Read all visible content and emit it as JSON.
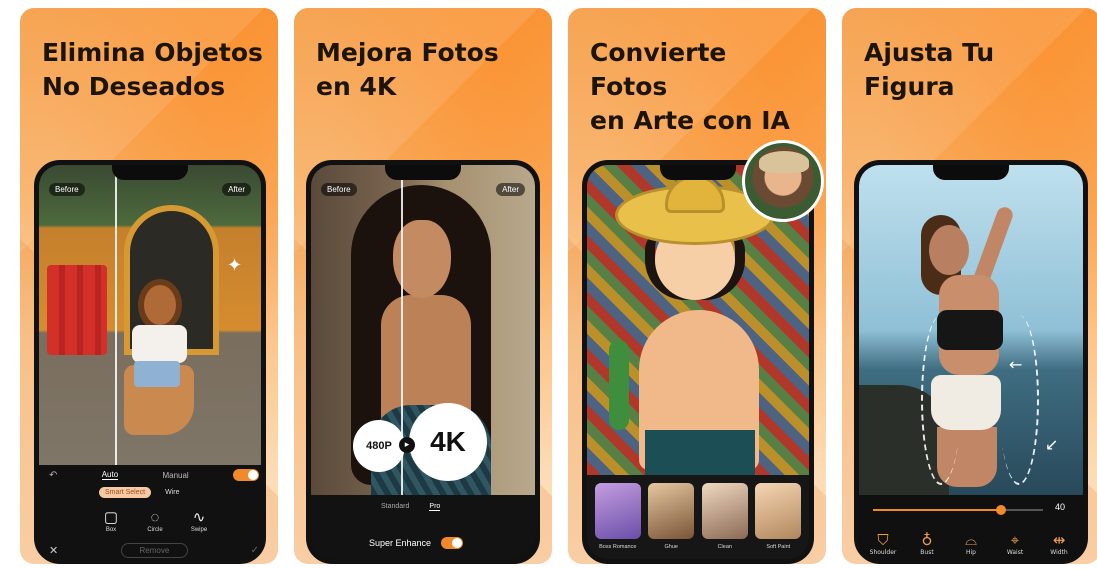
{
  "panels": [
    {
      "title": "Elimina Objetos\nNo Deseados",
      "before_label": "Before",
      "after_label": "After",
      "mode_tabs": [
        "Auto",
        "Manual"
      ],
      "select_options": [
        "Smart Select",
        "Wire"
      ],
      "tools": [
        {
          "icon": "box-select-icon",
          "label": "Box"
        },
        {
          "icon": "circle-select-icon",
          "label": "Circle"
        },
        {
          "icon": "lasso-icon",
          "label": "Swipe"
        }
      ],
      "remove_label": "Remove",
      "toggle_on": true
    },
    {
      "title": "Mejora Fotos\nen 4K",
      "before_label": "Before",
      "after_label": "After",
      "resolution_from": "480P",
      "resolution_to": "4K",
      "quality_tabs": [
        "Standard",
        "Pro"
      ],
      "enhance_label": "Super Enhance",
      "enhance_on": true
    },
    {
      "title": "Convierte\nFotos\nen Arte con IA",
      "styles": [
        "Boss Romance",
        "Ghue",
        "Clean",
        "Soft Paint"
      ]
    },
    {
      "title": "Ajusta Tu\nFigura",
      "slider_value": "40",
      "slider_fraction": 0.75,
      "body_tools": [
        "Shoulder",
        "Bust",
        "Hip",
        "Waist",
        "Width"
      ]
    }
  ],
  "colors": {
    "accent": "#f08a2a",
    "panel_top": "#f59a3f",
    "panel_bottom": "#fde3c4",
    "title_text": "#1c1408"
  }
}
